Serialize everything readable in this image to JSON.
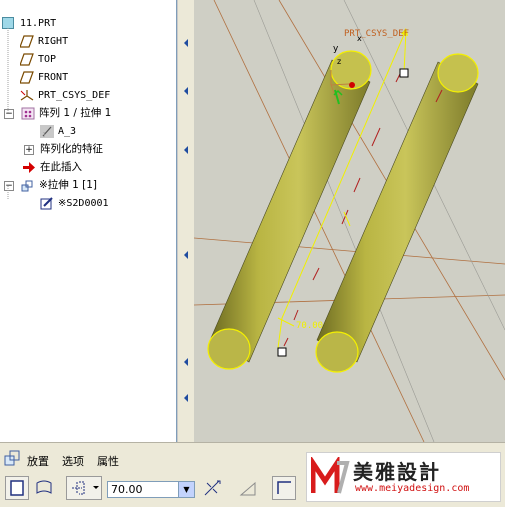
{
  "model_tree": {
    "root": "11.PRT",
    "items": [
      {
        "label": "RIGHT",
        "icon": "datum-plane-icon"
      },
      {
        "label": "TOP",
        "icon": "datum-plane-icon"
      },
      {
        "label": "FRONT",
        "icon": "datum-plane-icon"
      },
      {
        "label": "PRT_CSYS_DEF",
        "icon": "coordinate-system-icon"
      },
      {
        "label": "阵列 1 / 拉伸 1",
        "icon": "pattern-icon"
      },
      {
        "label": "A_3",
        "icon": "datum-axis-icon"
      },
      {
        "label": "阵列化的特征",
        "icon": "none"
      },
      {
        "label": "在此插入",
        "icon": "insert-here-arrow-icon"
      },
      {
        "label": "※拉伸 1 [1]",
        "icon": "extrude-icon"
      },
      {
        "label": "※S2D0001",
        "icon": "sketch-icon"
      }
    ]
  },
  "viewport": {
    "csys_label": "PRT_CSYS_DEF",
    "axis_y": "y",
    "axis_z": "z",
    "axis_x": "x",
    "dimension": "70.00",
    "cylinder_color": "#b5b040"
  },
  "dashboard": {
    "tabs": [
      "放置",
      "选项",
      "属性"
    ],
    "depth_value": "70.00"
  },
  "watermark": {
    "brand": "美雅設計",
    "url": "www.meiyadesign.com"
  }
}
